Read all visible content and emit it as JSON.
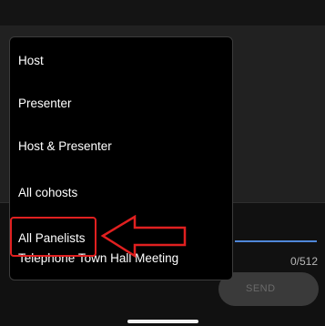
{
  "menu": {
    "items": [
      {
        "label": "Host"
      },
      {
        "label": "Presenter"
      },
      {
        "label": "Host & Presenter"
      },
      {
        "label": "All cohosts"
      },
      {
        "label": "All Panelists"
      },
      {
        "label": "Telephone Town Hall Meeting"
      }
    ]
  },
  "composer": {
    "char_count": "0/512",
    "send_label": "SEND"
  },
  "colors": {
    "annotation": "#e02020",
    "accent_line": "#4f87d8"
  },
  "icons": {
    "annotation_arrow": "left-arrow-icon"
  }
}
